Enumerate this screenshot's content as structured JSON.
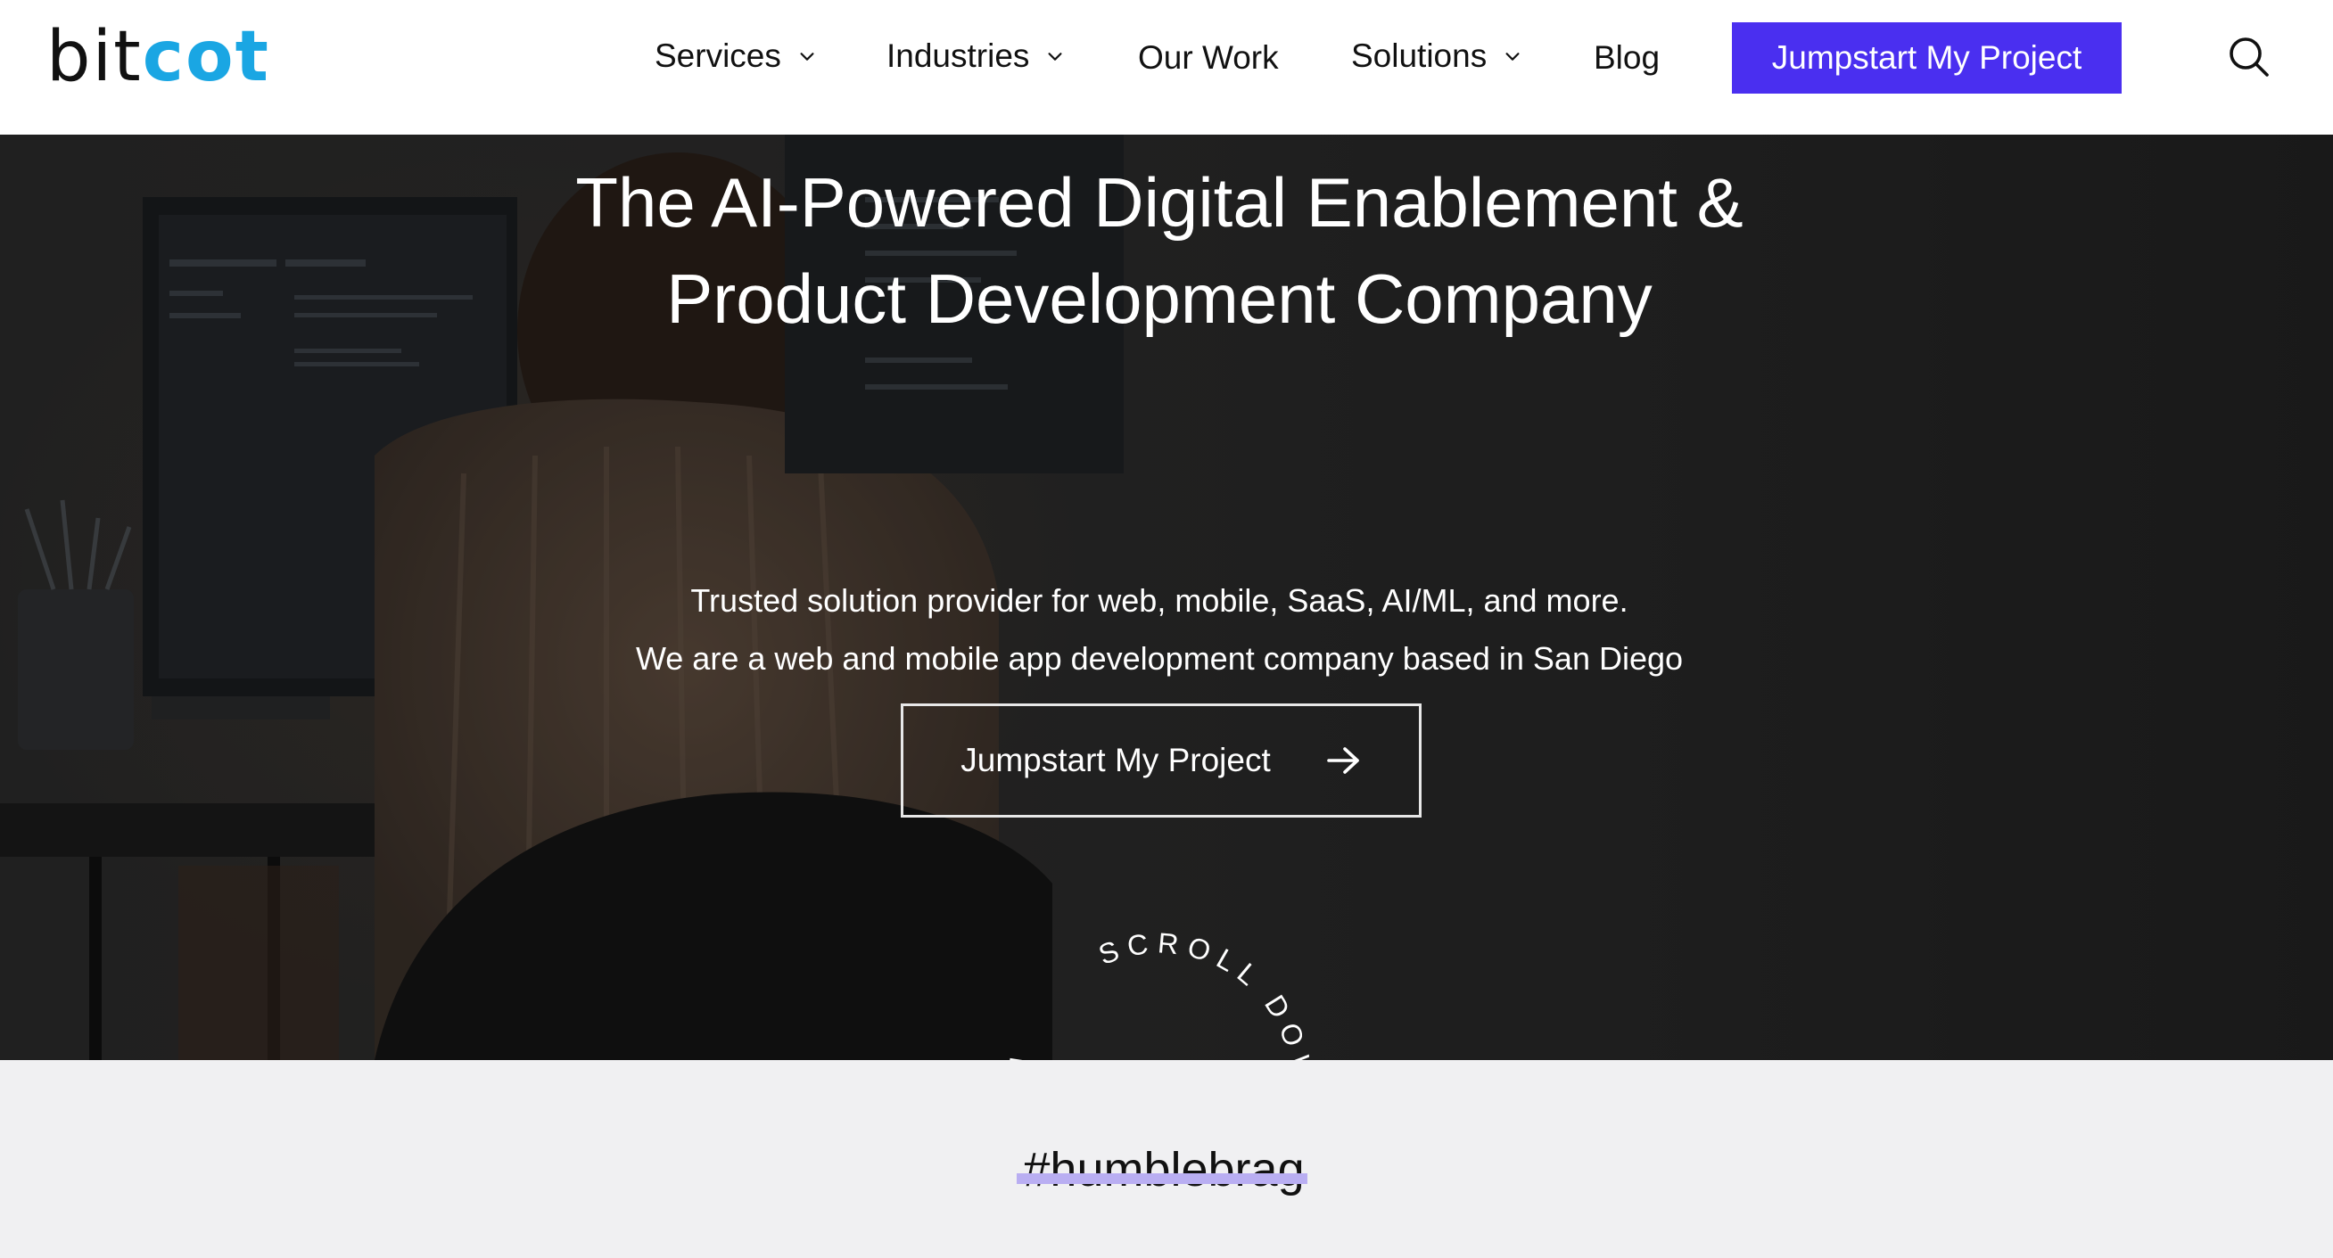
{
  "header": {
    "logo": {
      "part1": "bit",
      "part2": "cot"
    },
    "nav": [
      {
        "label": "Services",
        "dropdown": true
      },
      {
        "label": "Industries",
        "dropdown": true
      },
      {
        "label": "Our Work",
        "dropdown": false
      },
      {
        "label": "Solutions",
        "dropdown": true
      },
      {
        "label": "Blog",
        "dropdown": false
      }
    ],
    "cta_label": "Jumpstart My Project",
    "search_icon": "search-icon"
  },
  "hero": {
    "title_line1": "The AI-Powered Digital Enablement &",
    "title_line2": "Product Development Company",
    "subtitle_line1": "Trusted solution provider for web, mobile, SaaS, AI/ML, and more.",
    "subtitle_line2": "We are a web and mobile app development company based in San Diego",
    "cta_label": "Jumpstart My Project",
    "cta_icon": "arrow-right-icon",
    "scroll_text": "SCROLL DOWN"
  },
  "brag": {
    "label": "#humblebrag"
  },
  "colors": {
    "brand_blue": "#1aa6e3",
    "cta_purple": "#4a2ff0",
    "highlight": "#b9aef2",
    "strip_bg": "#f0f0f2"
  }
}
